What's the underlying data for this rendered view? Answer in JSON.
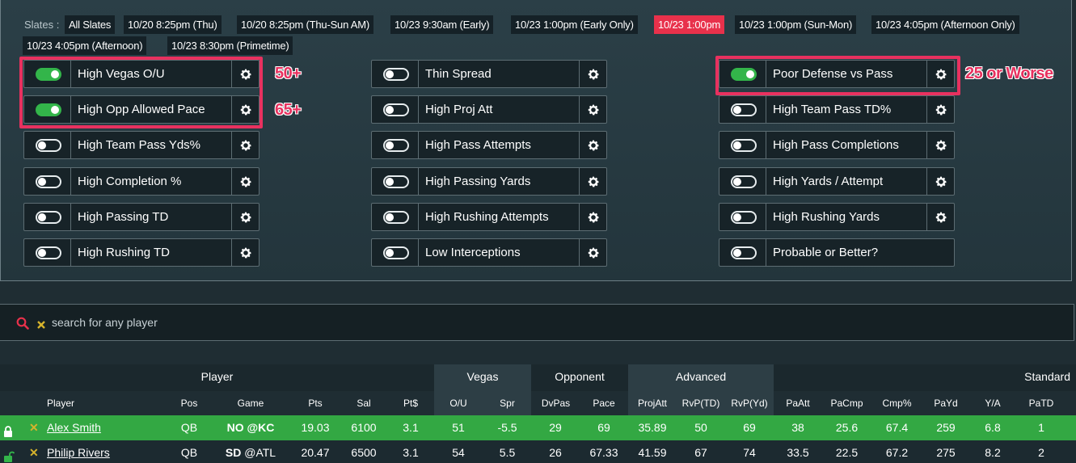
{
  "slates": {
    "label": "Slates :",
    "items": [
      "All Slates",
      "10/20 8:25pm (Thu)",
      "10/20 8:25pm (Thu-Sun AM)",
      "10/23 9:30am (Early)",
      "10/23 1:00pm (Early Only)",
      "10/23 1:00pm",
      "10/23 1:00pm (Sun-Mon)",
      "10/23 4:05pm (Afternoon Only)",
      "10/23 4:05pm (Afternoon)",
      "10/23 8:30pm (Primetime)"
    ],
    "active": "10/23 1:00pm"
  },
  "filters": {
    "col1": [
      {
        "label": "High Vegas O/U",
        "on": true
      },
      {
        "label": "High Opp Allowed Pace",
        "on": true
      },
      {
        "label": "High Team Pass Yds%",
        "on": false
      },
      {
        "label": "High Completion %",
        "on": false
      },
      {
        "label": "High Passing TD",
        "on": false
      },
      {
        "label": "High Rushing TD",
        "on": false
      }
    ],
    "col2": [
      {
        "label": "Thin Spread",
        "on": false
      },
      {
        "label": "High Proj Att",
        "on": false
      },
      {
        "label": "High Pass Attempts",
        "on": false
      },
      {
        "label": "High Passing Yards",
        "on": false
      },
      {
        "label": "High Rushing Attempts",
        "on": false
      },
      {
        "label": "Low Interceptions",
        "on": false
      }
    ],
    "col3": [
      {
        "label": "Poor Defense vs Pass",
        "on": true
      },
      {
        "label": "High Team Pass TD%",
        "on": false
      },
      {
        "label": "High Pass Completions",
        "on": false
      },
      {
        "label": "High Yards / Attempt",
        "on": false
      },
      {
        "label": "High Rushing Yards",
        "on": false
      },
      {
        "label": "Probable or Better?",
        "on": false
      }
    ]
  },
  "annotations": {
    "vegas": "50+",
    "pace": "65+",
    "defense": "25 or Worse"
  },
  "search": {
    "placeholder": "search for any player"
  },
  "table": {
    "groups": {
      "player": "Player",
      "vegas": "Vegas",
      "opponent": "Opponent",
      "advanced": "Advanced",
      "standard": "Standard"
    },
    "headers": [
      "Player",
      "Pos",
      "Game",
      "Pts",
      "Sal",
      "Pt$",
      "O/U",
      "Spr",
      "DvPas",
      "Pace",
      "ProjAtt",
      "RvP(TD)",
      "RvP(Yd)",
      "PaAtt",
      "PaCmp",
      "Cmp%",
      "PaYd",
      "Y/A",
      "PaTD"
    ],
    "rows": [
      {
        "player": "Alex Smith",
        "pos": "QB",
        "game_team": "NO",
        "game_opp": "@KC",
        "pts": "19.03",
        "sal": "6100",
        "ptd": "3.1",
        "ou": "51",
        "spr": "-5.5",
        "dvpas": "29",
        "pace": "69",
        "projatt": "35.89",
        "rvptd": "50",
        "rvpyd": "69",
        "paatt": "38",
        "pacmp": "25.6",
        "cmp": "67.4",
        "payd": "259",
        "ya": "6.8",
        "patd": "1"
      },
      {
        "player": "Philip Rivers",
        "pos": "QB",
        "game_team": "SD",
        "game_opp": "@ATL",
        "pts": "20.47",
        "sal": "6500",
        "ptd": "3.1",
        "ou": "54",
        "spr": "5.5",
        "dvpas": "26",
        "pace": "67.33",
        "projatt": "41.59",
        "rvptd": "67",
        "rvpyd": "74",
        "paatt": "33.5",
        "pacmp": "22.5",
        "cmp": "67.2",
        "payd": "275",
        "ya": "8.2",
        "patd": "2"
      }
    ]
  },
  "colors": {
    "accent": "#e8314b",
    "highlight": "#e8315f",
    "toggle_on": "#33b54a",
    "row_selected": "#33a843"
  }
}
